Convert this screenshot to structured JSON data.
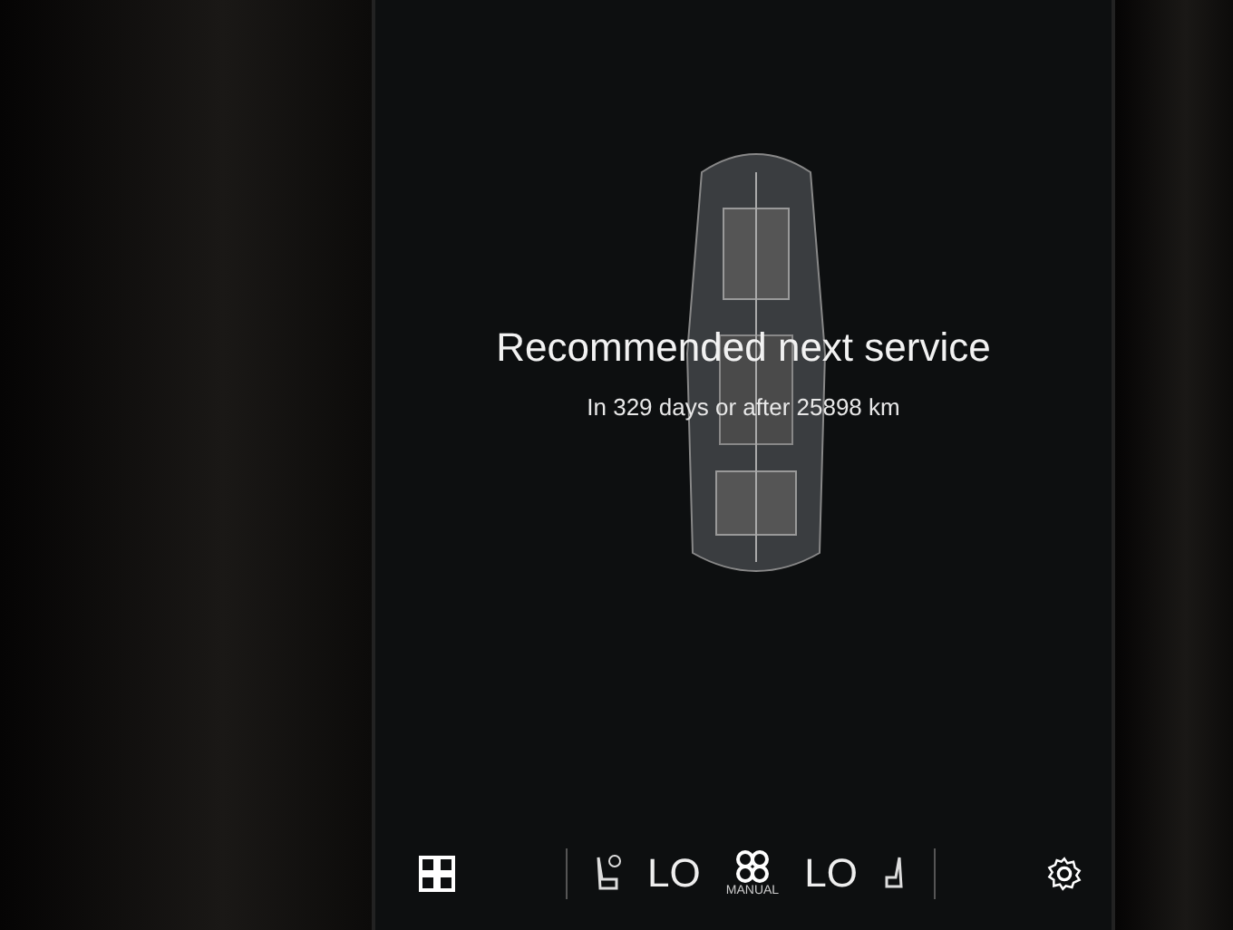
{
  "service": {
    "title": "Recommended next service",
    "detail": "In 329 days or after 25898 km"
  },
  "climate_bar": {
    "left_temperature": "LO",
    "fan_mode": "MANUAL",
    "right_temperature": "LO"
  }
}
